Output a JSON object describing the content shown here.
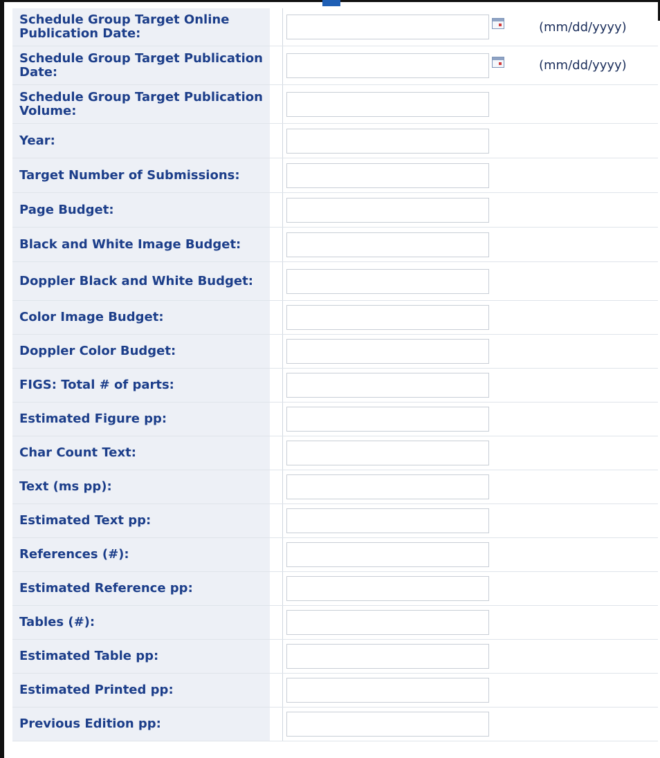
{
  "form": {
    "date_hint": "(mm/dd/yyyy)",
    "rows": [
      {
        "label": "Schedule Group Target Online Publication Date:",
        "value": ""
      },
      {
        "label": "Schedule Group Target Publication Date:",
        "value": ""
      },
      {
        "label": "Schedule Group Target Publication Volume:",
        "value": ""
      },
      {
        "label": "Year:",
        "value": ""
      },
      {
        "label": "Target Number of Submissions:",
        "value": ""
      },
      {
        "label": "Page Budget:",
        "value": ""
      },
      {
        "label": "Black and White Image Budget:",
        "value": ""
      },
      {
        "label": "Doppler Black and White Budget:",
        "value": ""
      },
      {
        "label": "Color Image Budget:",
        "value": ""
      },
      {
        "label": "Doppler Color Budget:",
        "value": ""
      },
      {
        "label": "FIGS: Total # of parts:",
        "value": ""
      },
      {
        "label": "Estimated Figure pp:",
        "value": ""
      },
      {
        "label": "Char Count Text:",
        "value": ""
      },
      {
        "label": "Text (ms pp):",
        "value": ""
      },
      {
        "label": "Estimated Text pp:",
        "value": ""
      },
      {
        "label": "References (#):",
        "value": ""
      },
      {
        "label": "Estimated Reference pp:",
        "value": ""
      },
      {
        "label": "Tables (#):",
        "value": ""
      },
      {
        "label": "Estimated Table pp:",
        "value": ""
      },
      {
        "label": "Estimated Printed pp:",
        "value": ""
      },
      {
        "label": "Previous Edition pp:",
        "value": ""
      }
    ]
  }
}
